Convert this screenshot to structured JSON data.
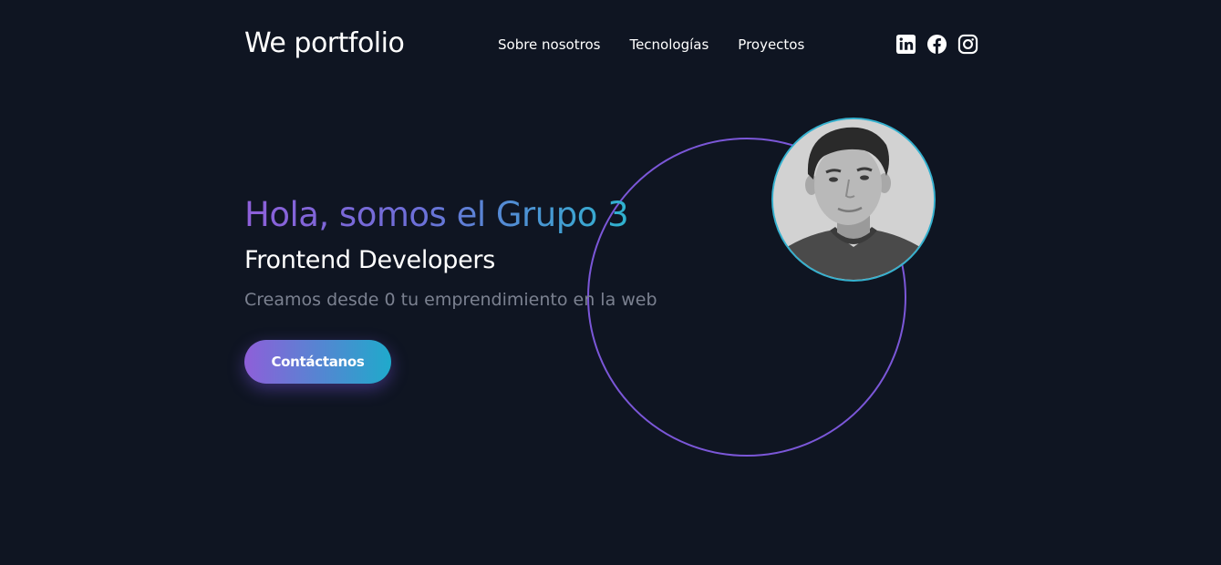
{
  "header": {
    "brand": "We portfolio",
    "nav": [
      {
        "label": "Sobre nosotros"
      },
      {
        "label": "Tecnologías"
      },
      {
        "label": "Proyectos"
      }
    ],
    "socials": [
      {
        "icon": "linkedin-icon"
      },
      {
        "icon": "facebook-icon"
      },
      {
        "icon": "instagram-icon"
      }
    ]
  },
  "hero": {
    "title": "Hola, somos el Grupo 3",
    "subtitle": "Frontend Developers",
    "description": "Creamos desde 0 tu emprendimiento en la web",
    "cta_label": "Contáctanos",
    "avatar_icon": "profile-photo"
  },
  "colors": {
    "background": "#0f1522",
    "accent_purple": "#8e5fd9",
    "accent_cyan": "#1faacb",
    "ring": "#7b57d8",
    "muted_text": "#7b8190"
  }
}
